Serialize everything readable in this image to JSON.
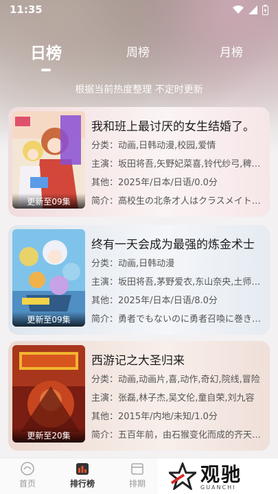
{
  "status": {
    "time": "11:35"
  },
  "tabs": [
    {
      "label": "日榜"
    },
    {
      "label": "周榜"
    },
    {
      "label": "月榜"
    }
  ],
  "subtitle": "根据当前热度整理 不定时更新",
  "cards": [
    {
      "title": "我和班上最讨厌的女生结婚了。",
      "category": "分类：动画,日韩动漫,校园,爱情",
      "cast": "主演：坂田将吾,矢野妃菜喜,铃代纱弓,稗田宁宁",
      "other": "其他：2025年/日本/日语/0.0分",
      "intro": "简介：高校生の北条才人はクラスメイトの桜森朱音と",
      "badge": "更新至09集"
    },
    {
      "title": "终有一天会成为最强的炼金术士",
      "category": "分类：动画,日韩动漫",
      "cast": "主演：坂田将吾,茅野爱衣,东山奈央,土师孝也",
      "other": "其他：2025年/日本/日语/8.0分",
      "intro": "简介：勇者でもないのに勇者召喚に巻き込まれ",
      "badge": "更新至09集"
    },
    {
      "title": "西游记之大圣归来",
      "category": "分类：动画,动画片,喜,动作,奇幻,院线,冒险",
      "cast": "主演：张磊,林子杰,吴文伦,童自荣,刘九容",
      "other": "其他：2015年/内地/未知/1.0分",
      "intro": "简介：五百年前，由石猴变化而成的齐天大圣孙悟空",
      "badge": "更新至20集"
    }
  ],
  "nav": [
    {
      "label": "首页",
      "icon": "home-icon"
    },
    {
      "label": "排行榜",
      "icon": "ranking-icon"
    },
    {
      "label": "排期",
      "icon": "schedule-icon"
    }
  ],
  "watermark": {
    "text": "观驰",
    "sub": "GUANCHI"
  },
  "colors": {
    "accent": "#ffffff",
    "active_nav": "#e0522b"
  }
}
